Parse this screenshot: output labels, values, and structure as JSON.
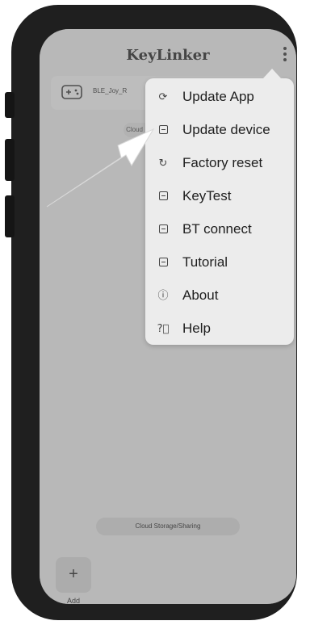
{
  "app": {
    "title": "KeyLinker"
  },
  "device": {
    "name": "BLE_Joy_R"
  },
  "middle_pill": {
    "text": "Cloud"
  },
  "menu": {
    "items": [
      {
        "label": "Update App",
        "icon": "refresh-icon"
      },
      {
        "label": "Update device",
        "icon": "upload-icon"
      },
      {
        "label": "Factory reset",
        "icon": "reset-icon"
      },
      {
        "label": "KeyTest",
        "icon": "keytest-icon"
      },
      {
        "label": "BT connect",
        "icon": "bt-connect-icon"
      },
      {
        "label": "Tutorial",
        "icon": "tutorial-icon"
      },
      {
        "label": "About",
        "icon": "info-icon"
      },
      {
        "label": "Help",
        "icon": "help-icon"
      }
    ]
  },
  "footer": {
    "cloud_label": "Cloud Storage/Sharing",
    "add_symbol": "+",
    "add_label": "Add"
  },
  "colors": {
    "phone_frame": "#1f1f1f",
    "screen_bg": "#e7e7e7",
    "menu_bg": "#ececec",
    "pointer_arrow": "#ffffff"
  }
}
